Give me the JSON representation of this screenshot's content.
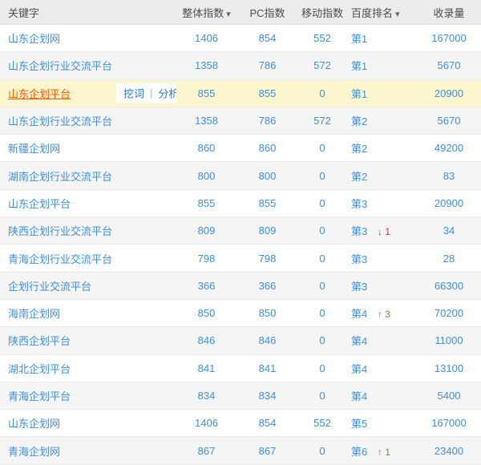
{
  "colors": {
    "link_blue": "#3f8fd9",
    "header_bg": "#ececec",
    "row_alt_bg": "#f5f5f5",
    "highlight_row_bg": "#fbf6cd",
    "highlight_keyword": "#ff5500",
    "action_link_blue": "#2b7bc3",
    "rank_up_green": "#55a516",
    "rank_down_red": "#d5352b"
  },
  "icons": {
    "sort_desc": "▾",
    "rank_up": "↑",
    "rank_down": "↓"
  },
  "table": {
    "actions_separator": "|",
    "columns": [
      {
        "label": "关键字",
        "sortable": false
      },
      {
        "label": "整体指数",
        "sortable": true
      },
      {
        "label": "PC指数",
        "sortable": false
      },
      {
        "label": "移动指数",
        "sortable": false
      },
      {
        "label": "百度排名",
        "sortable": true
      },
      {
        "label": "收录量",
        "sortable": false
      }
    ],
    "rows": [
      {
        "keyword": "山东企划网",
        "overall": "1406",
        "pc": "854",
        "mobile": "552",
        "rank": "第1",
        "indexed": "167000"
      },
      {
        "keyword": "山东企划行业交流平台",
        "overall": "1358",
        "pc": "786",
        "mobile": "572",
        "rank": "第1",
        "indexed": "5670"
      },
      {
        "keyword": "山东企划平台",
        "overall": "855",
        "pc": "855",
        "mobile": "0",
        "rank": "第1",
        "indexed": "20900",
        "highlighted": true,
        "actions": [
          "挖词",
          "分析"
        ]
      },
      {
        "keyword": "山东企划行业交流平台",
        "overall": "1358",
        "pc": "786",
        "mobile": "572",
        "rank": "第2",
        "indexed": "5670"
      },
      {
        "keyword": "新疆企划网",
        "overall": "860",
        "pc": "860",
        "mobile": "0",
        "rank": "第2",
        "indexed": "49200"
      },
      {
        "keyword": "湖南企划行业交流平台",
        "overall": "800",
        "pc": "800",
        "mobile": "0",
        "rank": "第2",
        "indexed": "83"
      },
      {
        "keyword": "山东企划平台",
        "overall": "855",
        "pc": "855",
        "mobile": "0",
        "rank": "第3",
        "indexed": "20900"
      },
      {
        "keyword": "陕西企划行业交流平台",
        "overall": "809",
        "pc": "809",
        "mobile": "0",
        "rank": "第3",
        "indexed": "34",
        "rank_change": {
          "dir": "down",
          "value": "1"
        }
      },
      {
        "keyword": "青海企划行业交流平台",
        "overall": "798",
        "pc": "798",
        "mobile": "0",
        "rank": "第3",
        "indexed": "28"
      },
      {
        "keyword": "企划行业交流平台",
        "overall": "366",
        "pc": "366",
        "mobile": "0",
        "rank": "第3",
        "indexed": "66300"
      },
      {
        "keyword": "海南企划网",
        "overall": "850",
        "pc": "850",
        "mobile": "0",
        "rank": "第4",
        "indexed": "70200",
        "rank_change": {
          "dir": "up",
          "value": "3"
        }
      },
      {
        "keyword": "陕西企划平台",
        "overall": "846",
        "pc": "846",
        "mobile": "0",
        "rank": "第4",
        "indexed": "11000"
      },
      {
        "keyword": "湖北企划平台",
        "overall": "841",
        "pc": "841",
        "mobile": "0",
        "rank": "第4",
        "indexed": "13100"
      },
      {
        "keyword": "青海企划平台",
        "overall": "834",
        "pc": "834",
        "mobile": "0",
        "rank": "第4",
        "indexed": "5400"
      },
      {
        "keyword": "山东企划网",
        "overall": "1406",
        "pc": "854",
        "mobile": "552",
        "rank": "第5",
        "indexed": "167000"
      },
      {
        "keyword": "青海企划网",
        "overall": "867",
        "pc": "867",
        "mobile": "0",
        "rank": "第6",
        "indexed": "23400",
        "rank_change": {
          "dir": "up",
          "value": "1"
        }
      }
    ]
  }
}
